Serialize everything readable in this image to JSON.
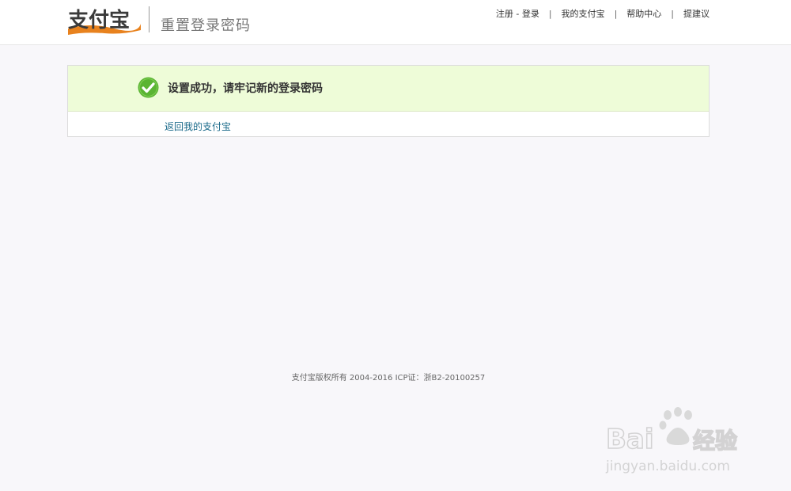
{
  "header": {
    "logo_text": "支付宝",
    "page_title": "重置登录密码",
    "nav": [
      {
        "label": "注册 - 登录"
      },
      {
        "label": "我的支付宝"
      },
      {
        "label": "帮助中心"
      },
      {
        "label": "提建议"
      }
    ]
  },
  "result": {
    "icon": "check-circle-icon",
    "message": "设置成功，请牢记新的登录密码",
    "back_link": "返回我的支付宝"
  },
  "footer": {
    "copyright": "支付宝版权所有 2004-2016 ICP证：浙B2-20100257"
  },
  "watermark": {
    "brand": "Bai 经验",
    "url": "jingyan.baidu.com"
  },
  "colors": {
    "success_bg": "#eefcd8",
    "check_green": "#5ab433",
    "link": "#1a6a8a",
    "logo_orange": "#e8821e"
  }
}
